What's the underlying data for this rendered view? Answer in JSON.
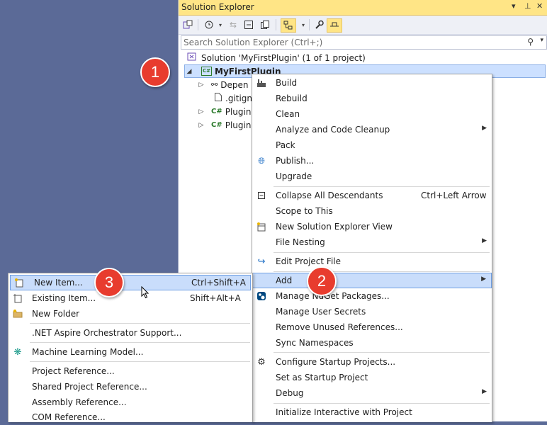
{
  "panel": {
    "title": "Solution Explorer",
    "title_controls": [
      "▾",
      "⊥",
      "✕"
    ],
    "search_placeholder": "Search Solution Explorer (Ctrl+;)"
  },
  "tree": {
    "solution": "Solution 'MyFirstPlugin' (1 of 1 project)",
    "project": "MyFirstPlugin",
    "children": [
      "Depen",
      ".gitign",
      "Plugin",
      "Plugin"
    ]
  },
  "context_menu": {
    "items": [
      {
        "label": "Build",
        "icon": "build-icon"
      },
      {
        "label": "Rebuild"
      },
      {
        "label": "Clean"
      },
      {
        "label": "Analyze and Code Cleanup",
        "submenu": true
      },
      {
        "label": "Pack"
      },
      {
        "label": "Publish...",
        "icon": "globe-icon"
      },
      {
        "label": "Upgrade"
      },
      {
        "label": "Collapse All Descendants",
        "shortcut": "Ctrl+Left Arrow",
        "icon": "collapse-icon"
      },
      {
        "label": "Scope to This"
      },
      {
        "label": "New Solution Explorer View",
        "icon": "new-view-icon"
      },
      {
        "label": "File Nesting",
        "submenu": true
      },
      {
        "label": "Edit Project File",
        "icon": "edit-icon"
      },
      {
        "label": "Add",
        "submenu": true,
        "highlighted": true
      },
      {
        "label": "Manage NuGet Packages...",
        "icon": "nuget-icon"
      },
      {
        "label": "Manage User Secrets"
      },
      {
        "label": "Remove Unused References..."
      },
      {
        "label": "Sync Namespaces"
      },
      {
        "label": "Configure Startup Projects...",
        "icon": "gear-icon"
      },
      {
        "label": "Set as Startup Project"
      },
      {
        "label": "Debug",
        "submenu": true
      },
      {
        "label": "Initialize Interactive with Project"
      }
    ]
  },
  "add_menu": {
    "items": [
      {
        "label": "New Item...",
        "shortcut": "Ctrl+Shift+A",
        "highlighted": true
      },
      {
        "label": "Existing Item...",
        "shortcut": "Shift+Alt+A"
      },
      {
        "label": "New Folder"
      },
      {
        "label": ".NET Aspire Orchestrator Support..."
      },
      {
        "label": "Machine Learning Model..."
      },
      {
        "label": "Project Reference..."
      },
      {
        "label": "Shared Project Reference..."
      },
      {
        "label": "Assembly Reference..."
      },
      {
        "label": "COM Reference..."
      }
    ]
  },
  "badges": [
    "1",
    "2",
    "3"
  ],
  "colors": {
    "accent": "#ffe586",
    "highlight": "#c9ddfb",
    "badge": "#e83c2e"
  }
}
